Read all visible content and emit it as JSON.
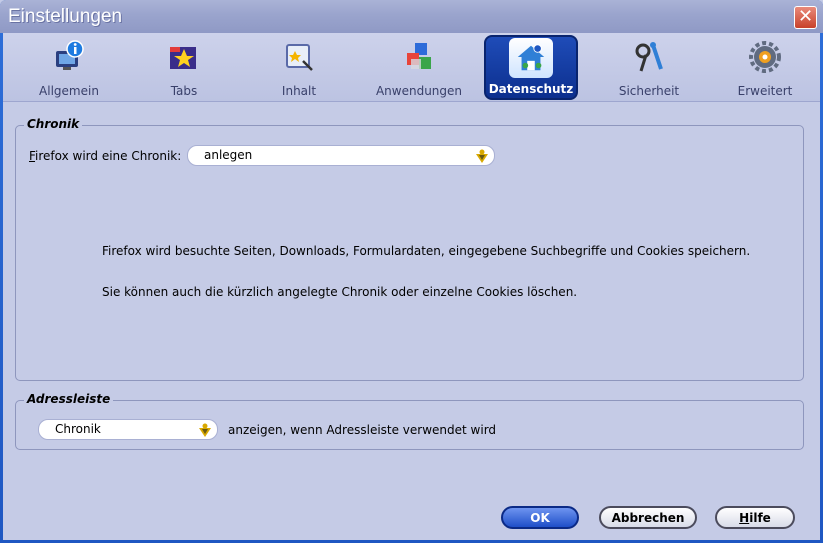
{
  "window": {
    "title": "Einstellungen",
    "close_glyph": "✕"
  },
  "toolbar": {
    "tabs": [
      {
        "label": "Allgemein",
        "icon": "general-icon"
      },
      {
        "label": "Tabs",
        "icon": "tabs-icon"
      },
      {
        "label": "Inhalt",
        "icon": "content-icon"
      },
      {
        "label": "Anwendungen",
        "icon": "applications-icon"
      },
      {
        "label": "Datenschutz",
        "icon": "privacy-icon",
        "selected": true
      },
      {
        "label": "Sicherheit",
        "icon": "security-icon"
      },
      {
        "label": "Erweitert",
        "icon": "advanced-icon"
      }
    ]
  },
  "history": {
    "legend": "Chronik",
    "label_prefix": "F",
    "label_rest": "irefox wird eine Chronik:",
    "select_value": "anlegen",
    "info_line1": "Firefox wird besuchte Seiten, Downloads, Formulardaten, eingegebene Suchbegriffe und Cookies speichern.",
    "info_line2": "Sie können auch die kürzlich angelegte Chronik oder einzelne Cookies löschen."
  },
  "addressbar": {
    "legend": "Adressleiste",
    "select_value": "Chronik",
    "suffix_text": "anzeigen, wenn Adressleiste verwendet wird"
  },
  "buttons": {
    "ok": "OK",
    "cancel": "Abbrechen",
    "help_prefix": "H",
    "help_rest": "ilfe"
  },
  "colors": {
    "accent": "#1f4cb8",
    "panel_bg": "#c5cbe6",
    "titlebar": "#9aa4cd"
  }
}
